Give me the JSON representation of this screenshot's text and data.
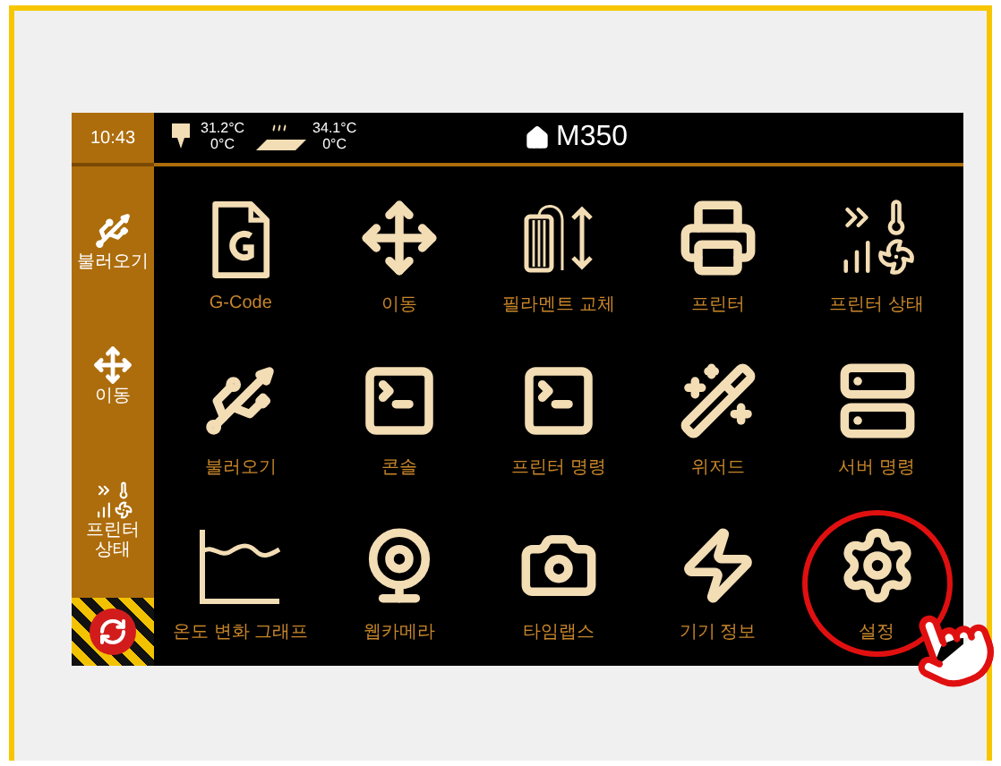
{
  "sidebar": {
    "time": "10:43",
    "items": [
      {
        "kind": "usb",
        "label": "불러오기"
      },
      {
        "kind": "move",
        "label": "이동"
      },
      {
        "kind": "status",
        "label": "프린터 상태"
      }
    ]
  },
  "status_bar": {
    "extruder": {
      "current": "31.2°C",
      "target": "0°C"
    },
    "bed": {
      "current": "34.1°C",
      "target": "0°C"
    },
    "title": "M350"
  },
  "menu": [
    {
      "kind": "gcode",
      "label": "G-Code",
      "highlighted": false
    },
    {
      "kind": "move",
      "label": "이동",
      "highlighted": false
    },
    {
      "kind": "filament",
      "label": "필라멘트 교체",
      "highlighted": false
    },
    {
      "kind": "printer",
      "label": "프린터",
      "highlighted": false
    },
    {
      "kind": "status",
      "label": "프린터 상태",
      "highlighted": false
    },
    {
      "kind": "usb",
      "label": "불러오기",
      "highlighted": false
    },
    {
      "kind": "console",
      "label": "콘솔",
      "highlighted": false
    },
    {
      "kind": "command",
      "label": "프린터 명령",
      "highlighted": false
    },
    {
      "kind": "wizard",
      "label": "위저드",
      "highlighted": false
    },
    {
      "kind": "server",
      "label": "서버 명령",
      "highlighted": false
    },
    {
      "kind": "graph",
      "label": "온도 변화 그래프",
      "highlighted": false
    },
    {
      "kind": "webcam",
      "label": "웹카메라",
      "highlighted": false
    },
    {
      "kind": "timelapse",
      "label": "타임랩스",
      "highlighted": false
    },
    {
      "kind": "info",
      "label": "기기 정보",
      "highlighted": false
    },
    {
      "kind": "settings",
      "label": "설정",
      "highlighted": true
    }
  ]
}
